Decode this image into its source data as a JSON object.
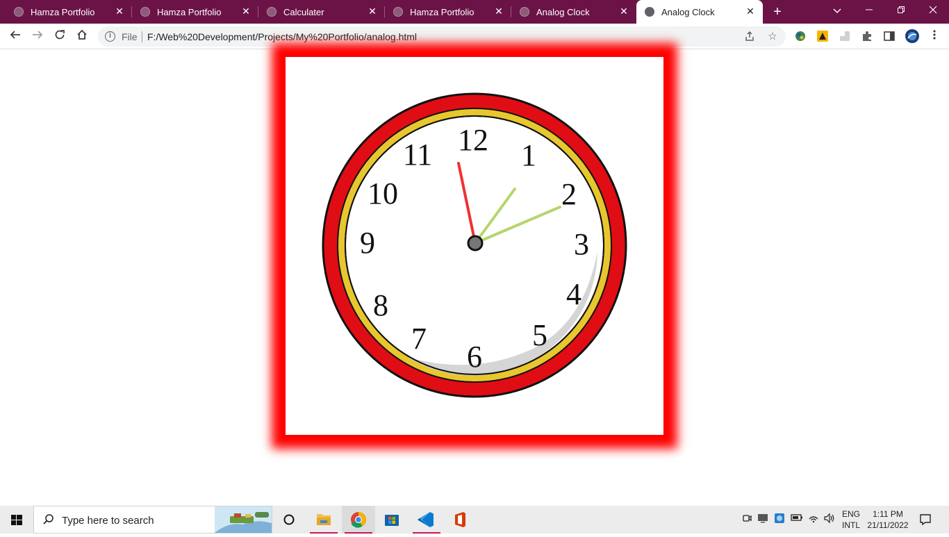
{
  "tabs": [
    {
      "title": "Hamza Portfolio",
      "active": false
    },
    {
      "title": "Hamza Portfolio",
      "active": false
    },
    {
      "title": "Calculater",
      "active": false
    },
    {
      "title": "Hamza Portfolio",
      "active": false
    },
    {
      "title": "Analog Clock",
      "active": false
    },
    {
      "title": "Analog Clock",
      "active": true
    }
  ],
  "address_bar": {
    "scheme_label": "File",
    "url": "F:/Web%20Development/Projects/My%20Portfolio/analog.html"
  },
  "clock_face": {
    "numerals": [
      "12",
      "1",
      "2",
      "3",
      "4",
      "5",
      "6",
      "7",
      "8",
      "9",
      "10",
      "11"
    ],
    "hands": {
      "hour": "1:10",
      "minute": "11",
      "second": "57"
    }
  },
  "taskbar": {
    "search_placeholder": "Type here to search",
    "language": "ENG",
    "layout": "INTL",
    "time": "1:11 PM",
    "date": "21/11/2022"
  },
  "colors": {
    "tab_strip": "#6b1346",
    "frame_border": "#ff0000",
    "second_hand": "#f03030",
    "hour_minute_hands": "#b5d56a",
    "clock_rim": "#e00d14",
    "clock_inner_ring": "#e8c62e"
  }
}
